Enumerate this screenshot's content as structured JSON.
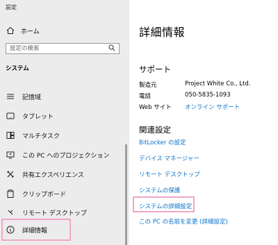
{
  "window": {
    "title": "設定"
  },
  "sidebar": {
    "home_label": "ホーム",
    "search_placeholder": "設定の検索",
    "section_label": "システム",
    "items": [
      {
        "label": "記憶域",
        "icon": "storage-icon"
      },
      {
        "label": "タブレット",
        "icon": "tablet-icon"
      },
      {
        "label": "マルチタスク",
        "icon": "multitask-icon"
      },
      {
        "label": "この PC へのプロジェクション",
        "icon": "projection-icon"
      },
      {
        "label": "共有エクスペリエンス",
        "icon": "shared-experience-icon"
      },
      {
        "label": "クリップボード",
        "icon": "clipboard-icon"
      },
      {
        "label": "リモート デスクトップ",
        "icon": "remote-desktop-icon"
      },
      {
        "label": "詳細情報",
        "icon": "info-icon",
        "selected": true
      }
    ]
  },
  "main": {
    "title": "詳細情報",
    "support": {
      "heading": "サポート",
      "rows": [
        {
          "key": "製造元",
          "value": "Project White Co., Ltd."
        },
        {
          "key": "電話",
          "value": "050-5835-1093"
        },
        {
          "key": "Web サイト",
          "value": "オンライン サポート"
        }
      ]
    },
    "related": {
      "heading": "関連設定",
      "links": [
        "BitLocker の設定",
        "デバイス マネージャー",
        "リモート デスクトップ",
        "システムの保護",
        "システムの詳細設定",
        "この PC の名前を変更 (詳細設定)"
      ]
    }
  },
  "colors": {
    "link": "#0a72c9",
    "highlight": "#f0a6c9",
    "sidebar_bg": "#ececec"
  }
}
